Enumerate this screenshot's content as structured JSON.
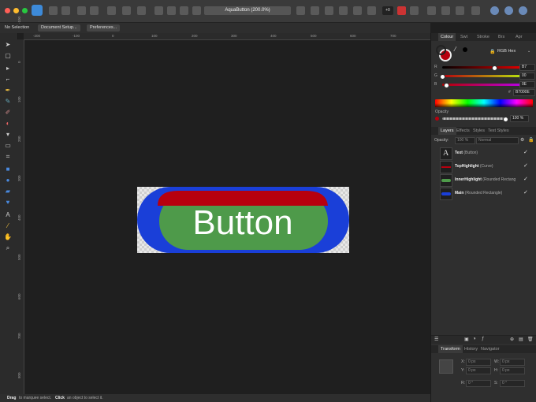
{
  "toolbar": {
    "document_title": "AquaButton (200.0%)",
    "zoom_value": "+0"
  },
  "context_bar": {
    "selection_status": "No Selection",
    "document_setup_label": "Document Setup...",
    "preferences_label": "Preferences..."
  },
  "rulers": {
    "h_labels": [
      "-200",
      "-100",
      "0",
      "100",
      "200",
      "300",
      "400",
      "500",
      "600",
      "700"
    ],
    "v_labels": [
      "-100",
      "0",
      "100",
      "200",
      "300",
      "400",
      "500",
      "600",
      "700",
      "800"
    ]
  },
  "canvas": {
    "button_text": "Button",
    "colors": {
      "main": "#1a3fd8",
      "inner_highlight": "#4e9a4a",
      "top_highlight": "#b7000e"
    }
  },
  "status": {
    "drag_word": "Drag",
    "drag_text": "to marquee select.",
    "click_word": "Click",
    "click_text": "an object to select it."
  },
  "color_panel": {
    "tabs": [
      "Colour",
      "Swt",
      "Stroke",
      "Brs",
      "Apr"
    ],
    "mode": "RGB Hex",
    "r_label": "R",
    "r_value": "B7",
    "g_label": "G",
    "g_value": "00",
    "b_label": "B",
    "b_value": "0E",
    "hex_value": "B7000E",
    "opacity_label": "Opacity",
    "opacity_value": "100 %",
    "current_color": "#b7000e"
  },
  "layers_panel": {
    "tabs": [
      "Layers",
      "Effects",
      "Styles",
      "Text Styles"
    ],
    "opacity_label": "Opacity:",
    "opacity_value": "100 %",
    "blend_mode": "Normal",
    "layers": [
      {
        "name": "Text",
        "type": "(Button)",
        "checked": "✓"
      },
      {
        "name": "TopHighlight",
        "type": "(Curve)",
        "checked": "✓"
      },
      {
        "name": "InnerHighlight",
        "type": "(Rounded Rectang",
        "checked": "✓"
      },
      {
        "name": "Main",
        "type": "(Rounded Rectangle)",
        "checked": "✓"
      }
    ]
  },
  "transform_panel": {
    "tabs": [
      "Transform",
      "History",
      "Navigator"
    ],
    "x_label": "X:",
    "x_value": "0 px",
    "y_label": "Y:",
    "y_value": "0 px",
    "w_label": "W:",
    "w_value": "0 px",
    "h_label": "H:",
    "h_value": "0 px",
    "r_label": "R:",
    "r_value": "0 °",
    "s_label": "S:",
    "s_value": "0 °"
  }
}
